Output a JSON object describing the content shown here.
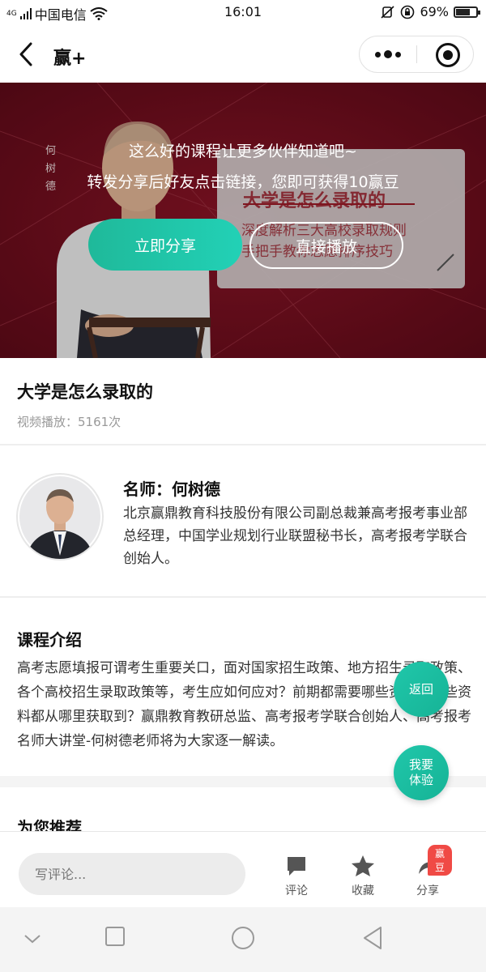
{
  "status_bar": {
    "network_type": "4G",
    "carrier": "中国电信",
    "time": "16:01",
    "battery_percent": "69%",
    "battery_level": 0.69
  },
  "nav": {
    "title": "赢+"
  },
  "banner": {
    "line1": "这么好的课程让更多伙伴知道吧~",
    "line2": "转发分享后好友点击链接，您即可获得10赢豆",
    "share_label": "立即分享",
    "play_label": "直接播放",
    "poster_name": "何树德",
    "poster_title": "大学是怎么录取的",
    "poster_line1": "深度解析三大高校录取规则",
    "poster_line2": "手把手教你志愿排序技巧",
    "colors": {
      "bg": "#7a1020",
      "accent": "#22c6aa"
    }
  },
  "course": {
    "title": "大学是怎么录取的",
    "play_count": "视频播放：5161次"
  },
  "teacher": {
    "name": "名师：何树德",
    "bio": "北京赢鼎教育科技股份有限公司副总裁兼高考报考事业部总经理，中国学业规划行业联盟秘书长，高考报考学联合创始人。"
  },
  "intro": {
    "title": "课程介绍",
    "body": "高考志愿填报可谓考生重要关口，面对国家招生政策、地方招生录取政策、各个高校招生录取政策等，考生应如何应对？前期都需要哪些资料？这些资料都从哪里获取到？赢鼎教育教研总监、高考报考学联合创始人、高考报考名师大讲堂-何树德老师将为大家逐一解读。"
  },
  "recommend": {
    "title": "为您推荐"
  },
  "float_buttons": {
    "back": "返回",
    "try_line1": "我要",
    "try_line2": "体验"
  },
  "comment_bar": {
    "placeholder": "写评论...",
    "comment_label": "评论",
    "favorite_label": "收藏",
    "share_label": "分享",
    "share_badge": "赢豆",
    "badge_color": "#f04a45"
  },
  "icons": [
    "back-icon",
    "more-icon",
    "close-icon",
    "comment-icon",
    "star-icon",
    "share-icon",
    "signal-icon",
    "wifi-icon",
    "battery-icon"
  ]
}
